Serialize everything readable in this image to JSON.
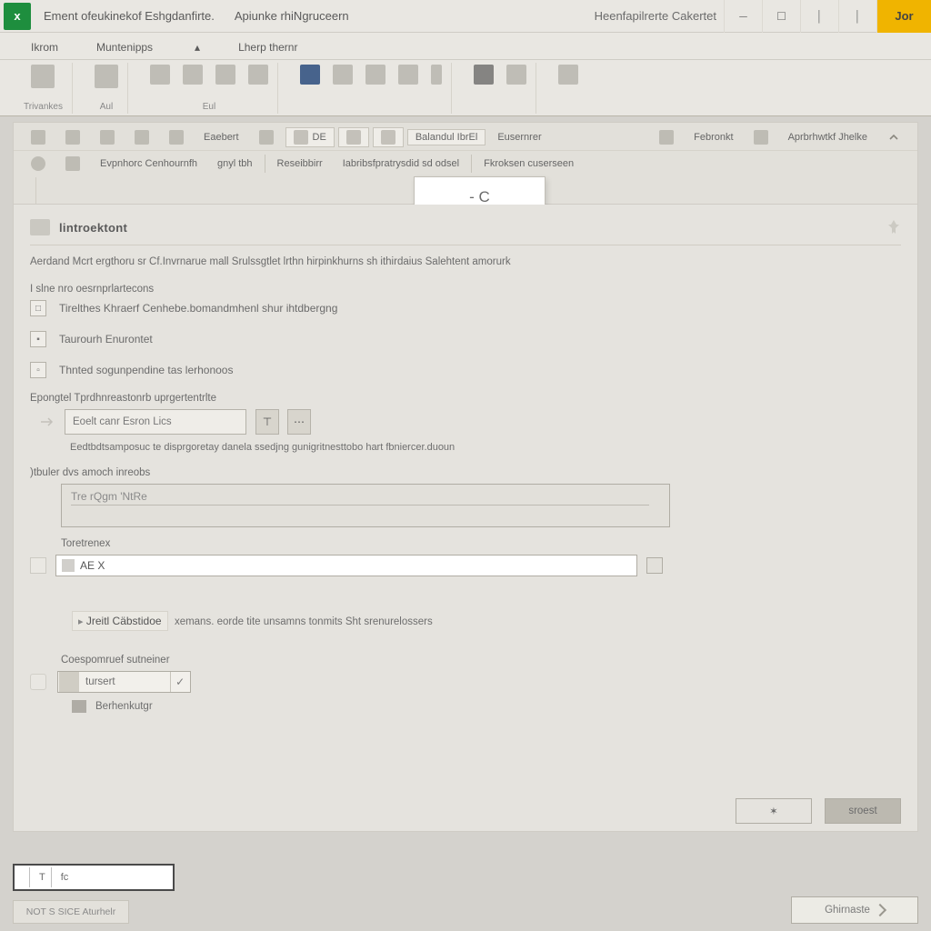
{
  "colors": {
    "brand_green": "#1e8e3e",
    "accent_yellow": "#f0b400"
  },
  "titlebar": {
    "app_glyph": "x",
    "title_a": "Ement  ofeukinekof  Eshgdanfirte.",
    "title_b": "Apiunke rhiNgruceern",
    "title_c": "Heenfapilrerte   Cakertet",
    "close_label": "Jor"
  },
  "ribbon_tabs": [
    "Ikrom",
    "Muntenipps",
    "Lherp thernr"
  ],
  "ribbon_groups": [
    {
      "label": "Trivankes",
      "icons": 1
    },
    {
      "label": "Aul",
      "icons": 1
    },
    {
      "label": "Eul",
      "icons": 4
    },
    {
      "label": "",
      "icons": 6
    },
    {
      "label": "",
      "icons": 2
    },
    {
      "label": "",
      "icons": 1
    }
  ],
  "sec_tb": {
    "row1": {
      "items": [
        "Eaebert",
        "DE",
        "Balandul IbrEl",
        "Eusernrer",
        "Febronkt",
        "Aprbrhwtkf Jhelke"
      ]
    },
    "row2": {
      "items": [
        "Evpnhorc Cenhournfh",
        "gnyl tbh",
        "Reseibbirr",
        "Iabribsfpratrysdid sd odsel",
        "Fkroksen cuserseen"
      ]
    }
  },
  "popup_text": "-  C",
  "panel": {
    "title": "lintroektont",
    "desc": "Aerdand  Mcrt  ergthoru sr Cf.Invrnarue mall Srulssgtlet  lrthn hirpinkhurns sh ithirdaius Salehtent amorurk",
    "opts_label": "I slne nro oesrnprlartecons",
    "opts": [
      "Tirelthes Khraerf Cenhebe.bomandmhenl  shur ihtdbergng",
      "Taurourh Enurontet",
      "Thnted sogunpendine tas lerhonoos"
    ],
    "exp_label": "Epongtel Tprdhnreastonrb uprgertentrlte",
    "exp_input": "Eoelt canr Esron Lics",
    "exp_hint": "Eedtbdtsamposuc te disprgoretay danela ssedjng gunigritnesttobo hart fbniercer.duoun",
    "area_label": ")tbuler dvs amoch inreobs",
    "area_placeholder": "Tre rQgm 'NtRe",
    "area2_label": "Toretrenex",
    "area2_value": "AE   X",
    "help_highlight": "Jreitl Cäbstidoe",
    "help_rest": "xemans. eorde  tite unsamns tonmits Sht srenurelossers",
    "combo_label": "Coespomruef sutneiner",
    "combo_value": "tursert",
    "combo_sub": "Berhenkutgr",
    "footer": {
      "cancel_icon": "✶",
      "ok": "sroest"
    }
  },
  "status_left": [
    "",
    "T",
    "fc"
  ],
  "bottom_soft": "NOT S SICE Aturhelr",
  "bottom_right": "Ghirnaste"
}
